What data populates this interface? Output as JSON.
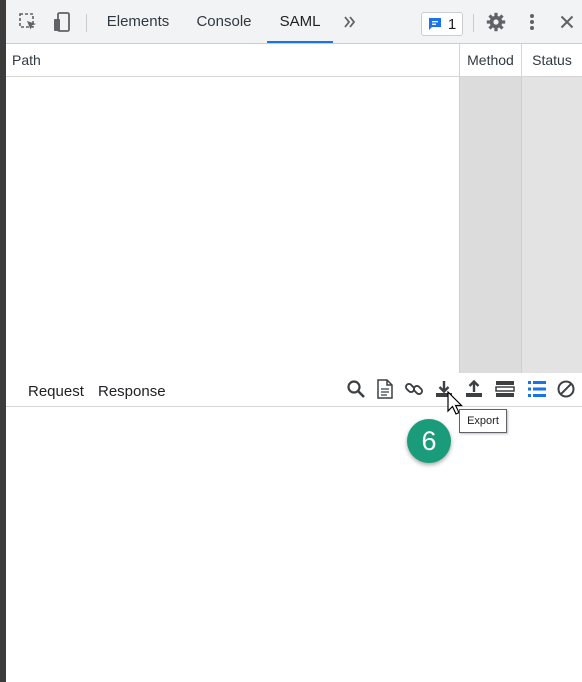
{
  "toolbar": {
    "icons": [
      "inspect-element-icon",
      "device-toggle-icon",
      "more-tabs-icon",
      "issues-icon",
      "gear-icon",
      "kebab-menu-icon",
      "close-icon"
    ],
    "tabs": [
      {
        "label": "Elements",
        "active": false
      },
      {
        "label": "Console",
        "active": false
      },
      {
        "label": "SAML",
        "active": true
      }
    ],
    "issues_count": "1"
  },
  "table": {
    "columns": [
      "Path",
      "Method",
      "Status"
    ],
    "rows": []
  },
  "detail": {
    "tabs": [
      "Request",
      "Response"
    ],
    "actions": [
      "search-icon",
      "document-icon",
      "link-icon",
      "export-icon",
      "import-icon",
      "layout-icon",
      "list-icon",
      "clear-icon"
    ],
    "tooltip": "Export"
  },
  "annotation": {
    "step": "6",
    "color": "#1a9c7a"
  },
  "colors": {
    "accent": "#1a73e8",
    "toolbar_bg": "#f1f3f4",
    "method_col_bg": "#dcdcdc"
  }
}
